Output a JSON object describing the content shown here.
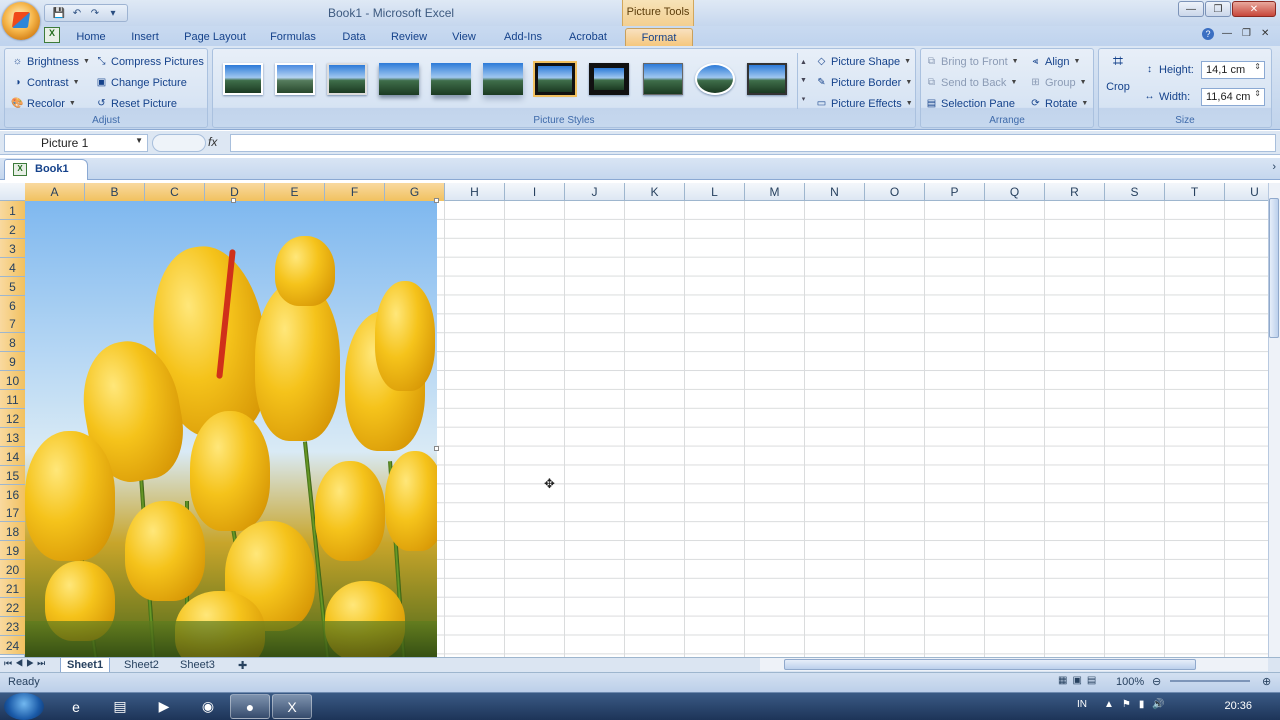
{
  "title_bar": {
    "doc_title": "Book1 - Microsoft Excel",
    "context_tab": "Picture Tools"
  },
  "tabs": [
    {
      "label": "Home"
    },
    {
      "label": "Insert"
    },
    {
      "label": "Page Layout"
    },
    {
      "label": "Formulas"
    },
    {
      "label": "Data"
    },
    {
      "label": "Review"
    },
    {
      "label": "View"
    },
    {
      "label": "Add-Ins"
    },
    {
      "label": "Acrobat"
    },
    {
      "label": "Format",
      "active": true
    }
  ],
  "ribbon": {
    "adjust": {
      "label": "Adjust",
      "brightness": "Brightness",
      "contrast": "Contrast",
      "recolor": "Recolor",
      "compress": "Compress Pictures",
      "change": "Change Picture",
      "reset": "Reset Picture"
    },
    "styles": {
      "label": "Picture Styles",
      "shape": "Picture Shape",
      "border": "Picture Border",
      "effects": "Picture Effects"
    },
    "arrange": {
      "label": "Arrange",
      "bring_front": "Bring to Front",
      "send_back": "Send to Back",
      "selection_pane": "Selection Pane",
      "align": "Align",
      "group": "Group",
      "rotate": "Rotate"
    },
    "size": {
      "label": "Size",
      "crop": "Crop",
      "height_label": "Height:",
      "height_value": "14,1 cm",
      "width_label": "Width:",
      "width_value": "11,64 cm"
    }
  },
  "formula_bar": {
    "name_box": "Picture 1",
    "fx": "fx"
  },
  "workbook": {
    "tab_label": "Book1"
  },
  "columns": [
    "A",
    "B",
    "C",
    "D",
    "E",
    "F",
    "G",
    "H",
    "I",
    "J",
    "K",
    "L",
    "M",
    "N",
    "O",
    "P",
    "Q",
    "R",
    "S",
    "T",
    "U"
  ],
  "rows": [
    "1",
    "2",
    "3",
    "4",
    "5",
    "6",
    "7",
    "8",
    "9",
    "10",
    "11",
    "12",
    "13",
    "14",
    "15",
    "16",
    "17",
    "18",
    "19",
    "20",
    "21",
    "22",
    "23",
    "24"
  ],
  "sheets": [
    {
      "label": "Sheet1",
      "active": true
    },
    {
      "label": "Sheet2"
    },
    {
      "label": "Sheet3"
    }
  ],
  "status": {
    "ready": "Ready",
    "zoom": "100%"
  },
  "taskbar": {
    "lang": "IN",
    "time": "20:36"
  },
  "colors": {
    "accent": "#15428b",
    "active_tab": "#f5c77d"
  }
}
